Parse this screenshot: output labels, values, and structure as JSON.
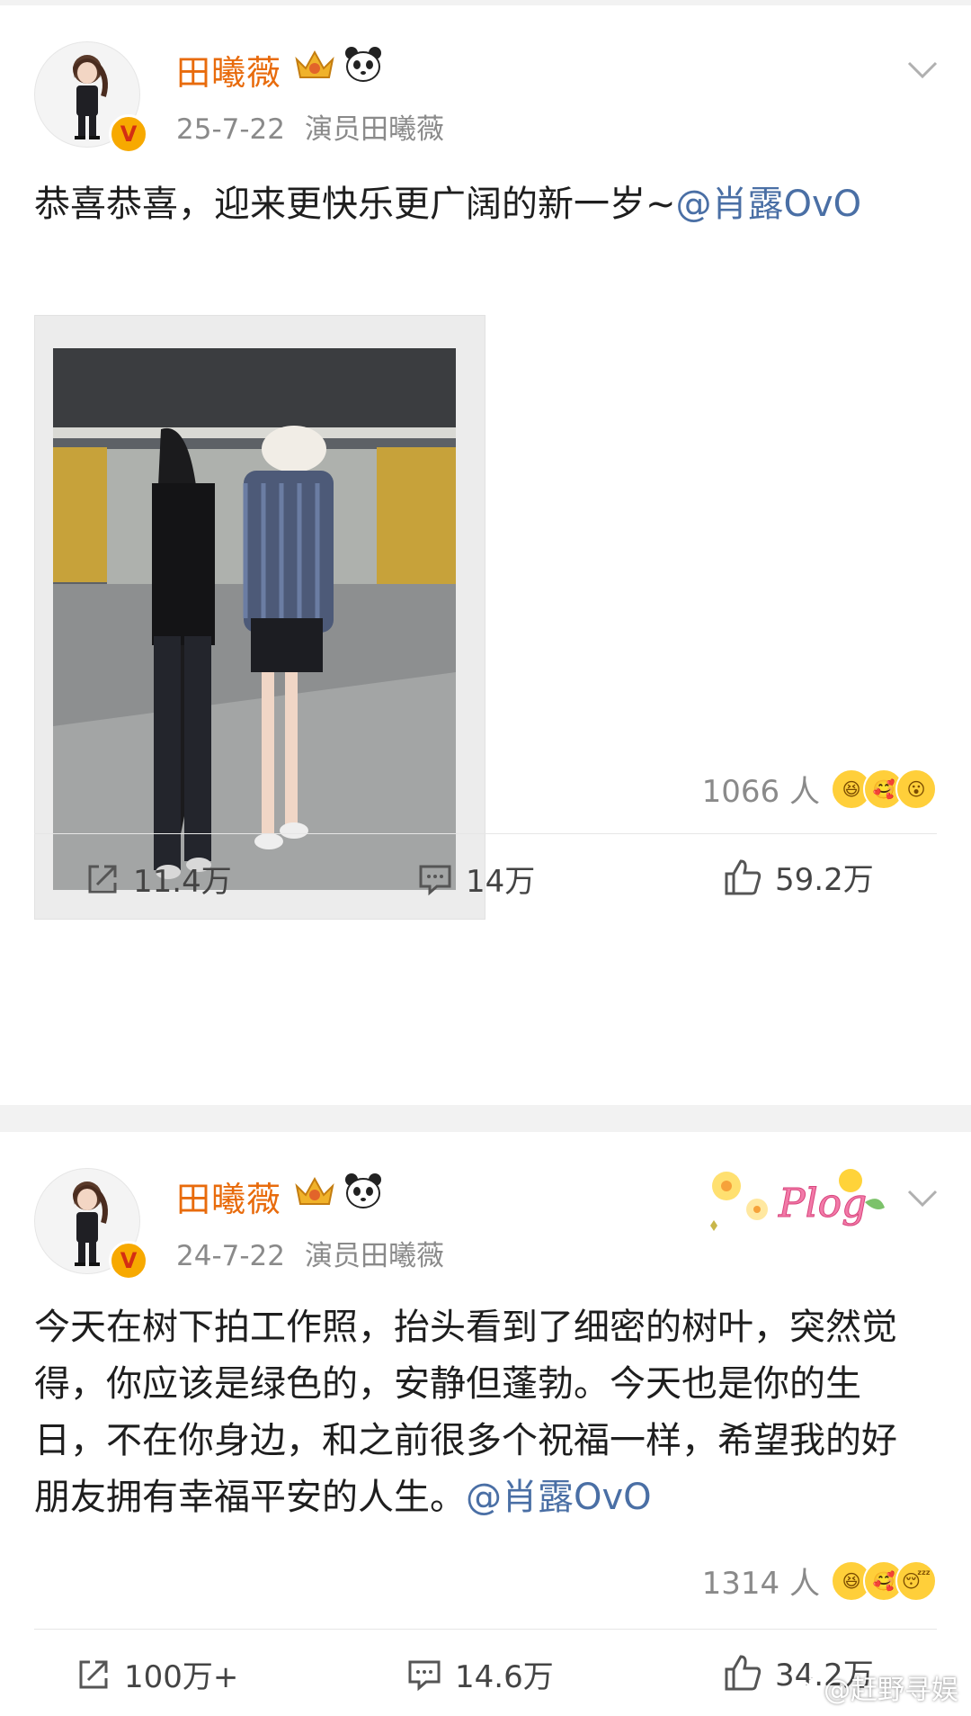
{
  "posts": [
    {
      "username": "田曦薇",
      "date": "25-7-22",
      "source": "演员田曦薇",
      "text": "恭喜恭喜，迎来更快乐更广阔的新一岁~",
      "mention": "@肖露OvO",
      "reaction_count": "1066 人",
      "share_count": "11.4万",
      "comment_count": "14万",
      "like_count": "59.2万"
    },
    {
      "username": "田曦薇",
      "date": "24-7-22",
      "source": "演员田曦薇",
      "text": "今天在树下拍工作照，抬头看到了细密的树叶，突然觉得，你应该是绿色的，安静但蓬勃。今天也是你的生日，不在你身边，和之前很多个祝福一样，希望我的好朋友拥有幸福平安的人生。",
      "mention": "@肖露OvO",
      "sticker_text": "Plog",
      "reaction_count": "1314 人",
      "share_count": "100万+",
      "comment_count": "14.6万",
      "like_count": "34.2万"
    }
  ],
  "badge_letter": "V",
  "watermark": "@赶野寻娱",
  "colors": {
    "username": "#e86b0c",
    "mention": "#4a6fa5",
    "meta": "#8a8a8a",
    "separator": "#f2f2f2"
  },
  "icons": [
    "chevron-down-icon",
    "crown-badge-icon",
    "panda-icon",
    "verified-badge-icon",
    "share-icon",
    "comment-icon",
    "like-icon",
    "weibo-logo-icon"
  ]
}
